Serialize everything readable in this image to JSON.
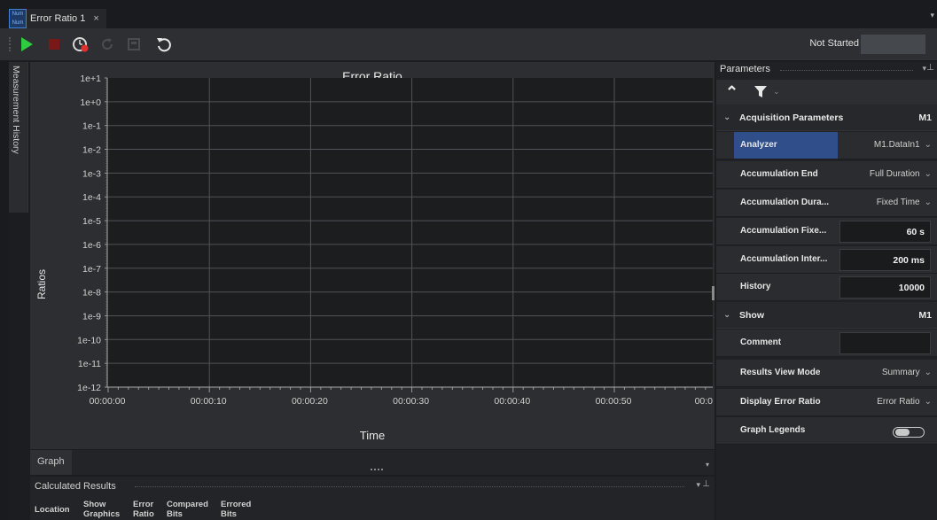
{
  "tab": {
    "app_icon_top": "Num",
    "app_icon_bottom": "Num",
    "title": "Error Ratio 1",
    "close": "×"
  },
  "toolbar": {
    "status": "Not Started",
    "buttons": [
      "play-icon",
      "stop-icon",
      "timer-icon",
      "refresh-icon",
      "export-icon",
      "undo-icon"
    ]
  },
  "side_panel": {
    "label": "Measurement History"
  },
  "chart_data": {
    "type": "line",
    "title": "Error Ratio",
    "xlabel": "Time",
    "ylabel": "Ratios",
    "y_scale": "log",
    "y_ticks": [
      "1e+1",
      "1e+0",
      "1e-1",
      "1e-2",
      "1e-3",
      "1e-4",
      "1e-5",
      "1e-6",
      "1e-7",
      "1e-8",
      "1e-9",
      "1e-10",
      "1e-11",
      "1e-12"
    ],
    "ylim": [
      1e-12,
      10
    ],
    "x_ticks": [
      "00:00:00",
      "00:00:10",
      "00:00:20",
      "00:00:30",
      "00:00:40",
      "00:00:50",
      "00:0"
    ],
    "series": [],
    "grid": true,
    "legend": "none"
  },
  "graph_tab": {
    "label": "Graph"
  },
  "calculated_results": {
    "title": "Calculated Results",
    "columns": [
      [
        "Location"
      ],
      [
        "Show",
        "Graphics"
      ],
      [
        "Error",
        "Ratio"
      ],
      [
        "Compared",
        "Bits"
      ],
      [
        "Errored",
        "Bits"
      ]
    ]
  },
  "parameters": {
    "title": "Parameters",
    "sections": [
      {
        "label": "Acquisition Parameters",
        "tag": "M1",
        "rows": [
          {
            "label": "Analyzer",
            "kind": "dropdown",
            "value": "M1.DataIn1",
            "selected": true
          },
          {
            "label": "Accumulation End",
            "kind": "dropdown",
            "value": "Full Duration"
          },
          {
            "label": "Accumulation Dura...",
            "kind": "dropdown",
            "value": "Fixed Time"
          },
          {
            "label": "Accumulation Fixe...",
            "kind": "input",
            "value": "60 s"
          },
          {
            "label": "Accumulation Inter...",
            "kind": "input",
            "value": "200 ms"
          },
          {
            "label": "History",
            "kind": "input",
            "value": "10000"
          }
        ]
      },
      {
        "label": "Show",
        "tag": "M1",
        "rows": [
          {
            "label": "Comment",
            "kind": "input",
            "value": ""
          },
          {
            "label": "Results View Mode",
            "kind": "dropdown",
            "value": "Summary"
          },
          {
            "label": "Display Error Ratio",
            "kind": "dropdown",
            "value": "Error Ratio"
          },
          {
            "label": "Graph Legends",
            "kind": "toggle",
            "value": "off"
          }
        ]
      }
    ]
  },
  "colors": {
    "accent_selected": "#2f4e8a",
    "play_green": "#2ecc40",
    "stop_red": "#8b1a1a"
  }
}
